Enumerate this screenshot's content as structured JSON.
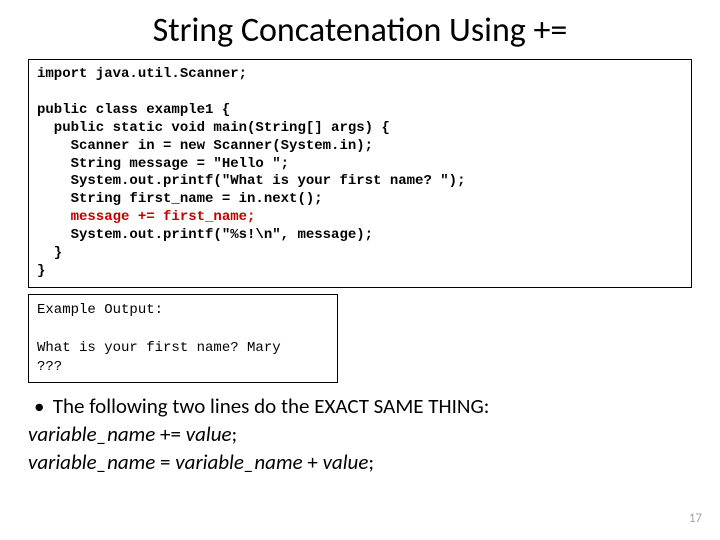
{
  "title": "String Concatenation Using +=",
  "code": {
    "l1": "import java.util.Scanner;",
    "l3": "public class example1 {",
    "l4": "  public static void main(String[] args) {",
    "l5": "    Scanner in = new Scanner(System.in);",
    "l6": "    String message = \"Hello \";",
    "l7": "    System.out.printf(\"What is your first name? \");",
    "l8": "    String first_name = in.next();",
    "l9": "    message += first_name;",
    "l10": "    System.out.printf(\"%s!\\n\", message);",
    "l11": "  }",
    "l12": "}"
  },
  "output": {
    "label": "Example Output:",
    "line1": "What is your first name? Mary",
    "line2": "???"
  },
  "bullet": "The following two lines do the EXACT SAME THING:",
  "var1": {
    "lhs": "variable_name",
    "op": " += ",
    "rhs": "value",
    "end": ";"
  },
  "var2": {
    "lhs": "variable_name",
    "op": " = ",
    "mid": "variable_name",
    "plus": " + ",
    "rhs": "value",
    "end": ";"
  },
  "pagenum": "17"
}
